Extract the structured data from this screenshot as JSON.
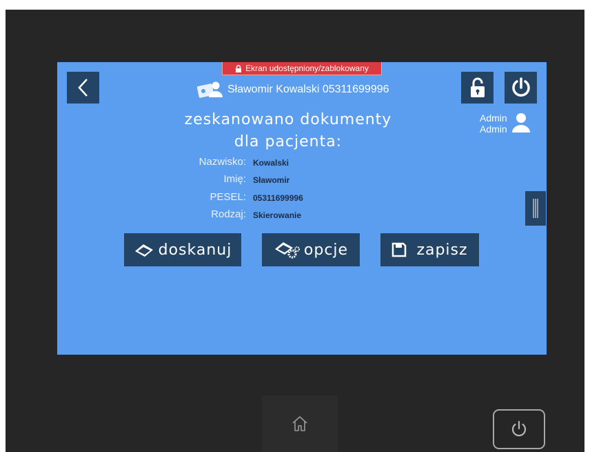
{
  "colors": {
    "screen_bg": "#5b9def",
    "button_bg": "#244466",
    "banner_bg": "#d93b41",
    "device_bg": "#262626"
  },
  "lock_banner": {
    "text": "Ekran udostępniony/zablokowany",
    "icon": "lock-icon"
  },
  "header": {
    "patient_line": "Sławomir Kowalski 05311699996",
    "patient_icon": "patient-card-icon"
  },
  "user": {
    "first_name": "Admin",
    "last_name": "Admin",
    "icon": "user-icon"
  },
  "title": {
    "line1": "zeskanowano dokumenty",
    "line2": "dla pacjenta:"
  },
  "fields": [
    {
      "label": "Nazwisko:",
      "value": "Kowalski"
    },
    {
      "label": "Imię:",
      "value": "Sławomir"
    },
    {
      "label": "PESEL:",
      "value": "05311699996"
    },
    {
      "label": "Rodzaj:",
      "value": "Skierowanie"
    }
  ],
  "buttons": {
    "rescan": "doskanuj",
    "options": "opcje",
    "save": "zapisz"
  }
}
